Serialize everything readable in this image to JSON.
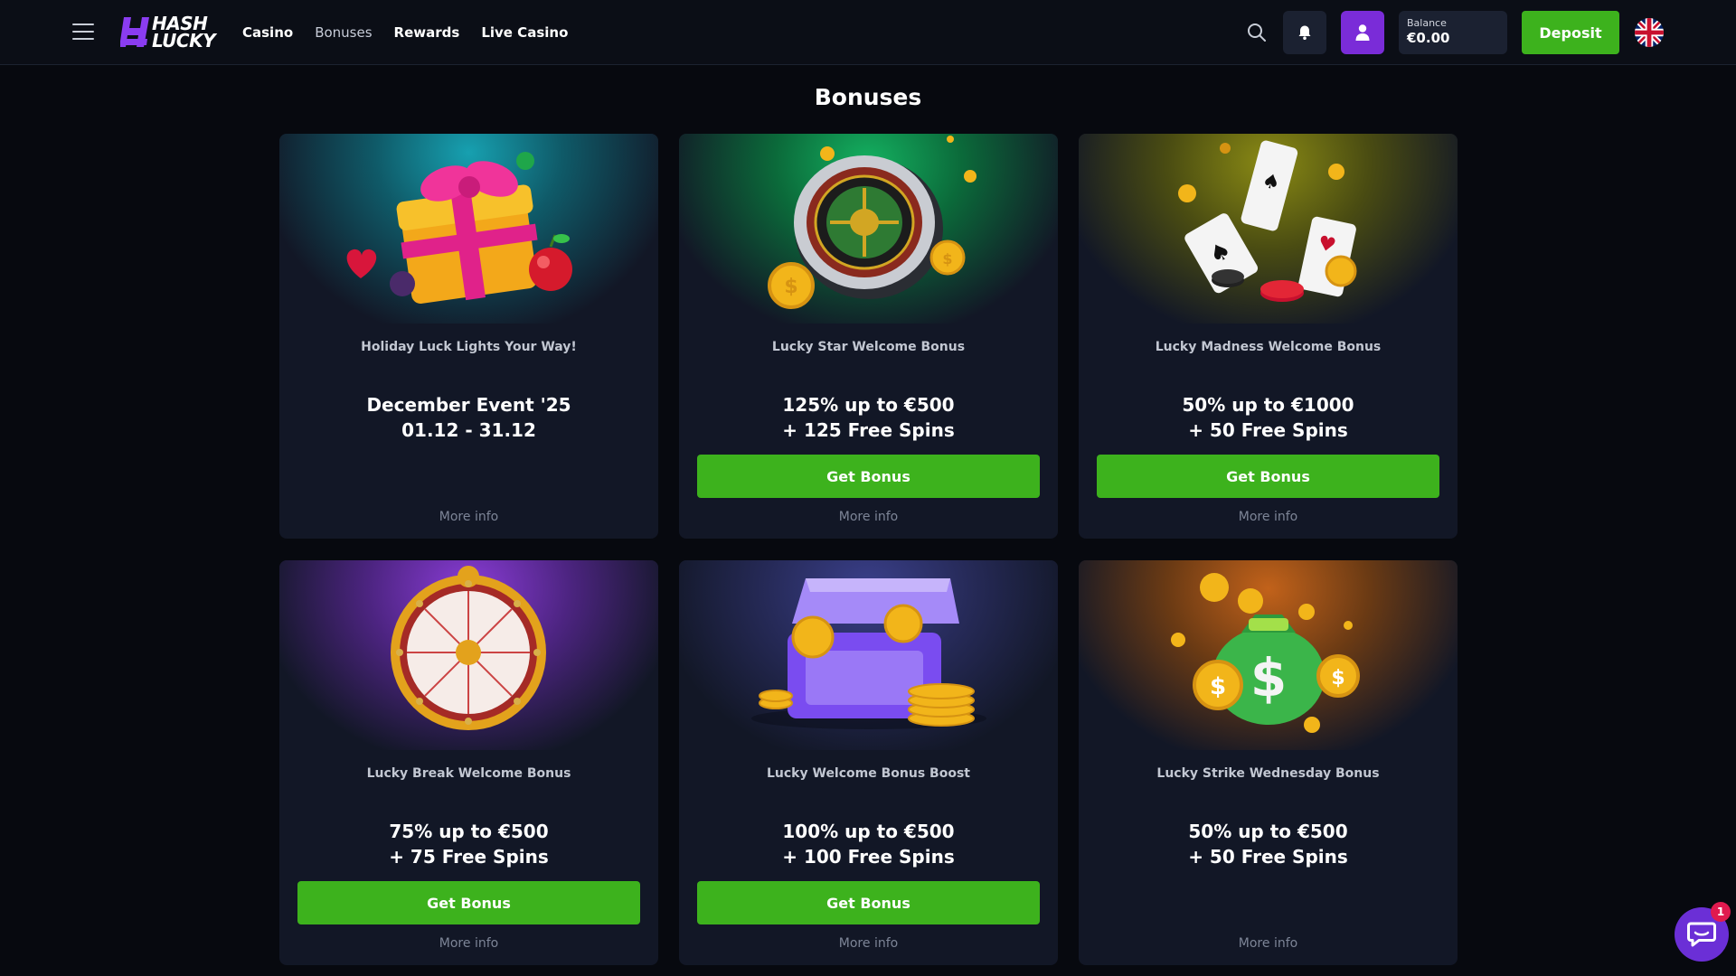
{
  "header": {
    "logo_line1": "HASH",
    "logo_line2": "LUCKY",
    "nav": [
      {
        "label": "Casino"
      },
      {
        "label": "Bonuses"
      },
      {
        "label": "Rewards"
      },
      {
        "label": "Live Casino"
      }
    ],
    "active_nav": "Bonuses",
    "balance_label": "Balance",
    "balance_value": "€0.00",
    "deposit_label": "Deposit",
    "language_flag": "uk-flag-icon"
  },
  "page": {
    "title": "Bonuses"
  },
  "cards": [
    {
      "subtitle": "Holiday Luck Lights Your Way!",
      "line1": "December Event '25",
      "line2": "01.12 - 31.12",
      "button": "",
      "more": "More info",
      "art": "gift-box-icon",
      "bg": "#0f6f7d"
    },
    {
      "subtitle": "Lucky Star Welcome Bonus",
      "line1": "125% up to €500",
      "line2": "+ 125 Free Spins",
      "button": "Get Bonus",
      "more": "More info",
      "art": "roulette-wheel-icon",
      "bg": "#0d7a45"
    },
    {
      "subtitle": "Lucky Madness Welcome Bonus",
      "line1": "50% up to €1000",
      "line2": "+ 50 Free Spins",
      "button": "Get Bonus",
      "more": "More info",
      "art": "playing-cards-icon",
      "bg": "#6a6a12"
    },
    {
      "subtitle": "Lucky Break Welcome Bonus",
      "line1": "75% up to €500",
      "line2": "+ 75 Free Spins",
      "button": "Get Bonus",
      "more": "More info",
      "art": "prize-wheel-icon",
      "bg": "#5a2c94"
    },
    {
      "subtitle": "Lucky Welcome Bonus Boost",
      "line1": "100% up to €500",
      "line2": "+ 100 Free Spins",
      "button": "Get Bonus",
      "more": "More info",
      "art": "treasure-chest-icon",
      "bg": "#2c3468"
    },
    {
      "subtitle": "Lucky Strike Wednesday Bonus",
      "line1": "50% up to €500",
      "line2": "+ 50 Free Spins",
      "button": "",
      "more": "More info",
      "art": "money-bag-icon",
      "bg": "#8a4a14"
    }
  ],
  "chat": {
    "badge": "1"
  },
  "colors": {
    "accent_green": "#3db21d",
    "brand_purple": "#7a2cd8",
    "card_bg": "#121726",
    "page_bg": "#07090f"
  }
}
